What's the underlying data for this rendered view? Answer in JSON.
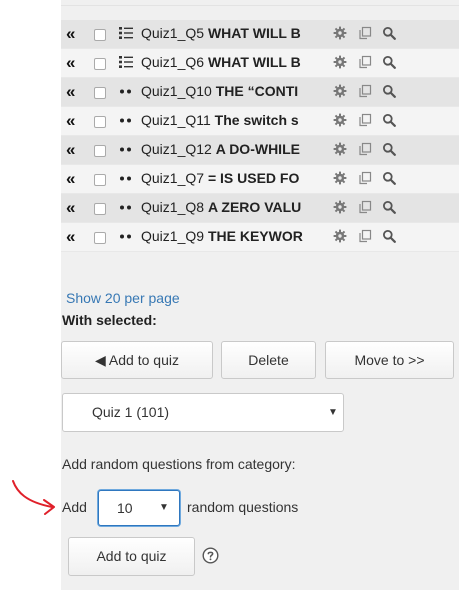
{
  "questions": [
    {
      "prefix": "Quiz1_Q5 ",
      "bold": "WHAT WILL B",
      "type_icon": "multichoice-icon"
    },
    {
      "prefix": "Quiz1_Q6 ",
      "bold": "WHAT WILL B",
      "type_icon": "multichoice-icon"
    },
    {
      "prefix": "Quiz1_Q10 ",
      "bold": "THE “CONTI",
      "type_icon": "truefalse-icon"
    },
    {
      "prefix": "Quiz1_Q11 ",
      "bold": "The switch s",
      "type_icon": "truefalse-icon"
    },
    {
      "prefix": "Quiz1_Q12 ",
      "bold": "A DO-WHILE",
      "type_icon": "truefalse-icon"
    },
    {
      "prefix": "Quiz1_Q7 ",
      "bold": "= IS USED FO",
      "type_icon": "truefalse-icon"
    },
    {
      "prefix": "Quiz1_Q8 ",
      "bold": "A ZERO VALU",
      "type_icon": "truefalse-icon"
    },
    {
      "prefix": "Quiz1_Q9 ",
      "bold": "THE KEYWOR",
      "type_icon": "truefalse-icon"
    }
  ],
  "move_glyph": "«",
  "show_per_page": "Show 20 per page",
  "with_selected": "With selected:",
  "buttons": {
    "add_to_quiz_top": "◀ Add to quiz",
    "delete": "Delete",
    "move_to": "Move to >>",
    "add_to_quiz_bottom": "Add to quiz"
  },
  "quiz_select": {
    "value": "Quiz 1 (101)",
    "caret": "▼"
  },
  "add_random_label": "Add random questions from category:",
  "add_word": "Add",
  "random_count": {
    "value": "10",
    "caret": "▼"
  },
  "random_questions": "random questions",
  "colors": {
    "link": "#3778b4",
    "arrow": "#e0202a",
    "focus": "#2f77bf"
  }
}
